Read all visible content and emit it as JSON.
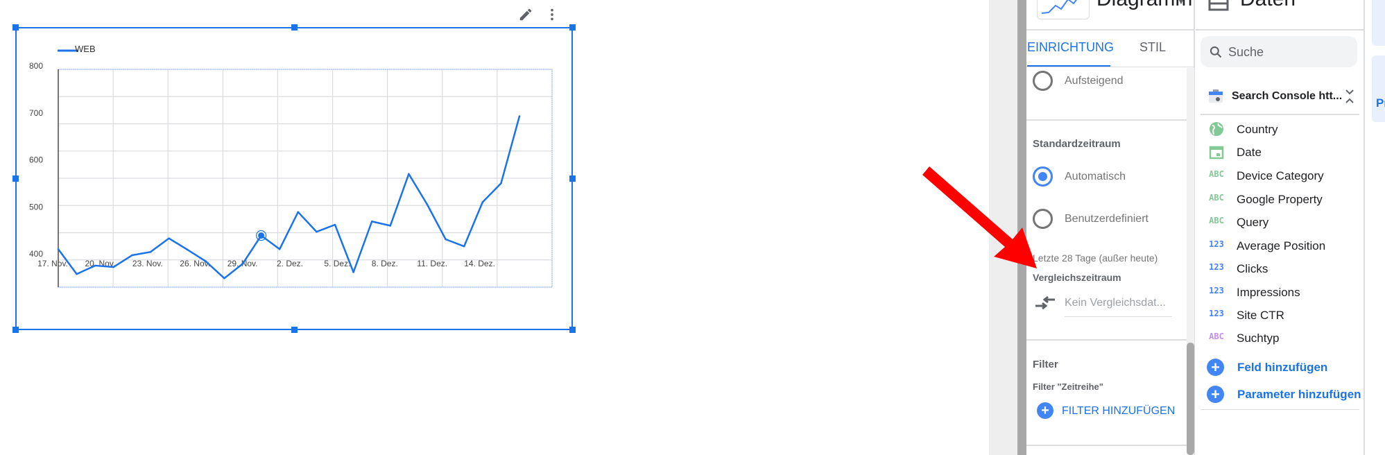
{
  "chart_toolbar": {
    "edit_icon": "pencil-icon",
    "more_icon": "more-vert-icon"
  },
  "chart_data": {
    "type": "line",
    "legend": {
      "entries": [
        "WEB"
      ],
      "placement": "top-left"
    },
    "series": [
      {
        "name": "WEB",
        "color": "#1a73e8",
        "values": [
          410,
          357,
          375,
          372,
          397,
          404,
          433,
          409,
          384,
          348,
          379,
          439,
          410,
          489,
          447,
          462,
          361,
          469,
          460,
          570,
          505,
          431,
          416,
          510,
          550,
          693
        ]
      }
    ],
    "x": [
      "17. Nov.",
      "18. Nov.",
      "19. Nov.",
      "20. Nov.",
      "21. Nov.",
      "22. Nov.",
      "23. Nov.",
      "24. Nov.",
      "25. Nov.",
      "26. Nov.",
      "27. Nov.",
      "28. Nov.",
      "29. Nov.",
      "30. Nov.",
      "1. Dez.",
      "2. Dez.",
      "3. Dez.",
      "4. Dez.",
      "5. Dez.",
      "6. Dez.",
      "7. Dez.",
      "8. Dez.",
      "9. Dez.",
      "10. Dez.",
      "11. Dez.",
      "12. Dez."
    ],
    "x_tick_labels": [
      "17. Nov.",
      "20. Nov.",
      "23. Nov.",
      "26. Nov.",
      "29. Nov.",
      "2. Dez.",
      "5. Dez.",
      "8. Dez.",
      "11. Dez.",
      "14. Dez."
    ],
    "y_tick_labels": [
      "800",
      "700",
      "600",
      "500",
      "400"
    ],
    "ylim": [
      330,
      800
    ],
    "grid": true,
    "highlighted_point": "28. Nov."
  },
  "setup_panel": {
    "chart_type": "Diagramm",
    "tabs": [
      {
        "label": "EINRICHTUNG",
        "active": true
      },
      {
        "label": "STIL",
        "active": false
      }
    ],
    "sort_option": "Aufsteigend",
    "date_range": {
      "title": "Standardzeitraum",
      "options": [
        {
          "label": "Automatisch",
          "selected": true
        },
        {
          "label": "Benutzerdefiniert",
          "selected": false
        }
      ],
      "hint": "Letzte 28 Tage (außer heute)"
    },
    "compare": {
      "title": "Vergleichszeitraum",
      "value": "Kein Vergleichsdat..."
    },
    "filter": {
      "title": "Filter",
      "subtitle": "Filter \"Zeitreihe\"",
      "add_label": "FILTER HINZUFÜGEN"
    }
  },
  "data_panel": {
    "title": "Daten",
    "search_placeholder": "Suche",
    "source": "Search Console htt...",
    "fields": [
      {
        "type": "geo",
        "label": "Country"
      },
      {
        "type": "date",
        "label": "Date"
      },
      {
        "type": "ABC",
        "label": "Device Category"
      },
      {
        "type": "ABC",
        "label": "Google Property"
      },
      {
        "type": "ABC",
        "label": "Query"
      },
      {
        "type": "123",
        "label": "Average Position"
      },
      {
        "type": "123",
        "label": "Clicks"
      },
      {
        "type": "123",
        "label": "Impressions"
      },
      {
        "type": "123",
        "label": "Site CTR"
      },
      {
        "type": "ABC",
        "label": "Suchtyp"
      }
    ],
    "add_field": "Feld hinzufügen",
    "add_parameter": "Parameter hinzufügen"
  },
  "right_strip": {
    "partial_label": "Pr"
  },
  "colors": {
    "accent": "#1a73e8",
    "dimension": "#81c995",
    "metric": "#4285f4",
    "annotation_arrow": "#ff0000"
  }
}
